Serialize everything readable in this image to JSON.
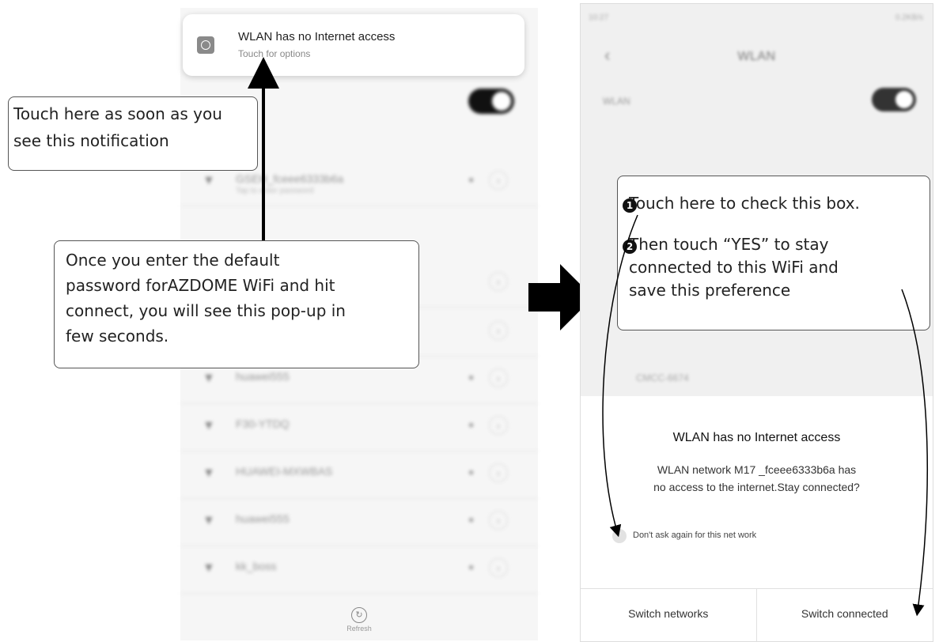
{
  "notification": {
    "title": "WLAN has no Internet access",
    "subtitle": "Touch for options"
  },
  "left_phone": {
    "networks": [
      {
        "name": "GSEH_fceee6333b6a",
        "sub": "Tap to enter password",
        "locked": true
      },
      {
        "name": "",
        "sub": "",
        "locked": false
      },
      {
        "name": "",
        "sub": "",
        "locked": false
      },
      {
        "name": "huawei555",
        "sub": "",
        "locked": true
      },
      {
        "name": "F30-YTDQ",
        "sub": "",
        "locked": true
      },
      {
        "name": "HUAWEI-MXWBAS",
        "sub": "",
        "locked": true
      },
      {
        "name": "huawei555",
        "sub": "",
        "locked": true
      },
      {
        "name": "kk_boss",
        "sub": "",
        "locked": true
      }
    ],
    "refresh_label": "Refresh"
  },
  "callouts": {
    "notification_hint": [
      "Touch here as soon as you",
      "see this notification"
    ],
    "password_hint": [
      "Once you enter the default",
      "password forAZDOME WiFi and hit",
      "connect, you will see this pop-up in",
      "few seconds."
    ],
    "step1": "Touch here to check this box.",
    "step2": [
      "Then touch “YES” to stay",
      "connected to this WiFi and",
      "save this preference"
    ],
    "badge1": "1",
    "badge2": "2"
  },
  "right_phone": {
    "status_time": "10:27",
    "status_right": "0.2KB/s",
    "title": "WLAN",
    "wlan_label": "WLAN",
    "section_label": "",
    "visible_network": "CMCC-6674",
    "dialog": {
      "title": "WLAN has no Internet access",
      "message_line1": "WLAN network  M17  _fceee6333b6a has",
      "message_line2": "no access to the internet.Stay connected?",
      "checkbox_label": "Don't ask again for this net work",
      "button_left": "Switch networks",
      "button_right": "Switch connected"
    }
  },
  "colors": {
    "toggle_on": "#111111",
    "callout_border": "#555555",
    "arrow": "#000000"
  }
}
